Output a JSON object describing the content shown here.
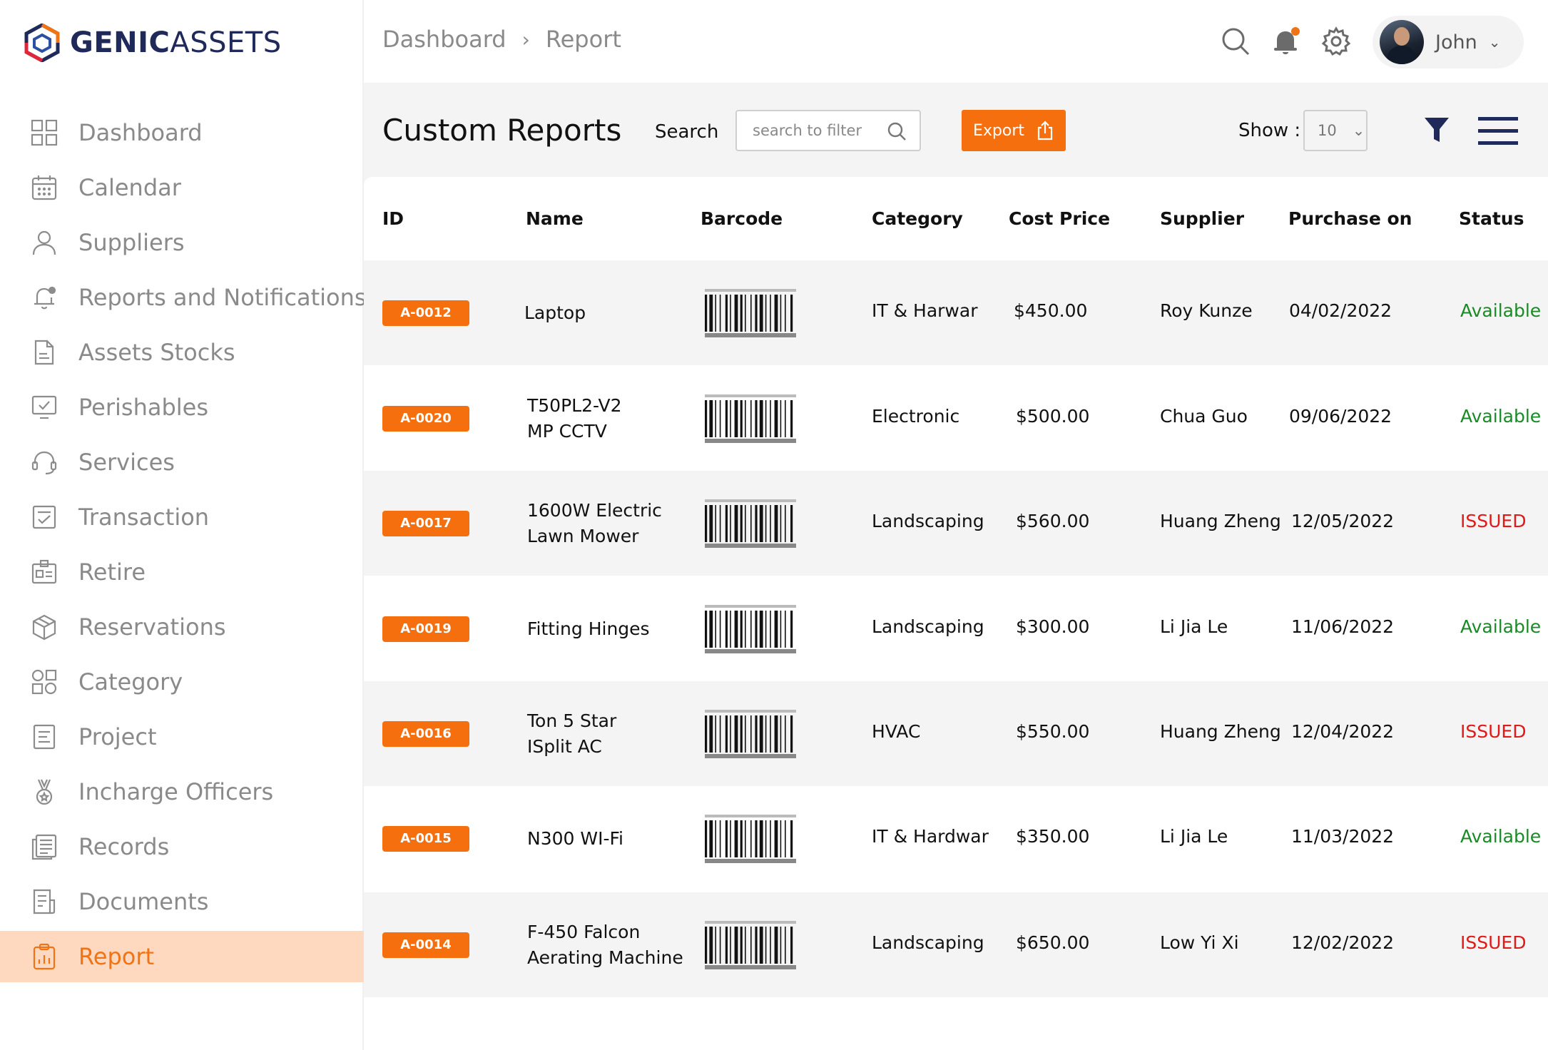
{
  "brand": {
    "name_bold": "GENIC",
    "name_thin": "ASSETS"
  },
  "sidebar": {
    "items": [
      {
        "label": "Dashboard",
        "icon": "grid-icon"
      },
      {
        "label": "Calendar",
        "icon": "calendar-icon"
      },
      {
        "label": "Suppliers",
        "icon": "user-icon"
      },
      {
        "label": "Reports and Notifications",
        "icon": "bell-notification-icon"
      },
      {
        "label": "Assets Stocks",
        "icon": "document-icon"
      },
      {
        "label": "Perishables",
        "icon": "checked-screen-icon"
      },
      {
        "label": "Services",
        "icon": "headset-icon"
      },
      {
        "label": "Transaction",
        "icon": "checklist-icon"
      },
      {
        "label": "Retire",
        "icon": "id-card-icon"
      },
      {
        "label": "Reservations",
        "icon": "box-icon"
      },
      {
        "label": "Category",
        "icon": "category-icon"
      },
      {
        "label": "Project",
        "icon": "project-icon"
      },
      {
        "label": "Incharge Officers",
        "icon": "medal-icon"
      },
      {
        "label": "Records",
        "icon": "records-icon"
      },
      {
        "label": "Documents",
        "icon": "documents-icon"
      },
      {
        "label": "Report",
        "icon": "clipboard-chart-icon",
        "active": true
      }
    ]
  },
  "header": {
    "breadcrumb": [
      "Dashboard",
      "Report"
    ],
    "breadcrumb_sep": "›",
    "user_name": "John",
    "user_chevron": "⌄"
  },
  "toolbar": {
    "title": "Custom Reports",
    "search_label": "Search",
    "search_placeholder": "search to filter",
    "export_label": "Export",
    "show_label": "Show :",
    "show_value": "10",
    "show_chevron": "⌄"
  },
  "colors": {
    "accent": "#f56f0f",
    "active_bg": "#ffd9bf",
    "status_available": "#1a8a26",
    "status_issued": "#e01919",
    "navy": "#1f2a5a"
  },
  "table": {
    "columns": [
      "ID",
      "Name",
      "Barcode",
      "Category",
      "Cost Price",
      "Supplier",
      "Purchase on",
      "Status"
    ],
    "rows": [
      {
        "id": "A-0012",
        "name": "Laptop",
        "category": "IT & Harwar",
        "cost": "$450.00",
        "supplier": "Roy Kunze",
        "purchase": "04/02/2022",
        "status": "Available"
      },
      {
        "id": "A-0020",
        "name": "T50PL2-V2\nMP CCTV",
        "category": "Electronic",
        "cost": "$500.00",
        "supplier": "Chua Guo",
        "purchase": "09/06/2022",
        "status": "Available"
      },
      {
        "id": "A-0017",
        "name": "1600W Electric\nLawn Mower",
        "category": "Landscaping",
        "cost": "$560.00",
        "supplier": "Huang Zheng",
        "purchase": "12/05/2022",
        "status": "ISSUED"
      },
      {
        "id": "A-0019",
        "name": "Fitting Hinges",
        "category": "Landscaping",
        "cost": "$300.00",
        "supplier": "Li Jia Le",
        "purchase": "11/06/2022",
        "status": "Available"
      },
      {
        "id": "A-0016",
        "name": "Ton 5 Star\nISplit AC",
        "category": "HVAC",
        "cost": "$550.00",
        "supplier": "Huang Zheng",
        "purchase": "12/04/2022",
        "status": "ISSUED"
      },
      {
        "id": "A-0015",
        "name": "N300 WI-Fi",
        "category": "IT & Hardwar",
        "cost": "$350.00",
        "supplier": "Li Jia Le",
        "purchase": "11/03/2022",
        "status": "Available"
      },
      {
        "id": "A-0014",
        "name": "F-450 Falcon\nAerating Machine",
        "category": "Landscaping",
        "cost": "$650.00",
        "supplier": "Low Yi Xi",
        "purchase": "12/02/2022",
        "status": "ISSUED"
      }
    ]
  }
}
